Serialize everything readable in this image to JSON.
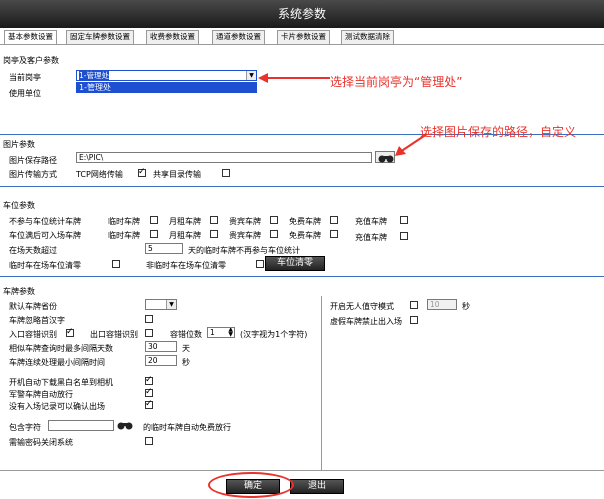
{
  "window": {
    "title": "系统参数"
  },
  "tabs": [
    "基本参数设置",
    "固定车牌参数设置",
    "收费参数设置",
    "通道参数设置",
    "卡片参数设置",
    "测试数据清除"
  ],
  "booth": {
    "section": "岗亭及客户参数",
    "current_label": "当前岗亭",
    "current_value": "1-管理处",
    "dropdown_option": "1-管理处",
    "unit_label": "使用单位"
  },
  "picture": {
    "section": "图片参数",
    "path_label": "图片保存路径",
    "path_value": "E:\\PIC\\",
    "mode_label": "图片传输方式",
    "tcp_label": "TCP网络传输",
    "share_label": "共享目录传输"
  },
  "parking": {
    "section": "车位参数",
    "row1_label": "不参与车位统计车牌",
    "row2_label": "车位满后可入场车牌",
    "types": [
      "临时车牌",
      "月租车牌",
      "贵宾车牌",
      "免费车牌",
      "充值车牌"
    ],
    "days_label": "在场天数超过",
    "days_value": "5",
    "days_suffix": "天的临时车牌不再参与车位统计",
    "temp_clear_label": "临时车在场车位清零",
    "nontemp_clear_label": "非临时车在场车位清零",
    "clear_button": "车位清零"
  },
  "plate": {
    "section": "车牌参数",
    "default_province_label": "默认车牌省份",
    "ignore_first_label": "车牌忽略首汉字",
    "entry_fault_label": "入口容错识别",
    "exit_fault_label": "出口容错识别",
    "fault_digits_label": "容错位数",
    "fault_digits_value": "1",
    "fault_digits_note": "(汉字视为1个字符)",
    "similar_days_label": "相似车牌查询时最多间隔天数",
    "similar_days_value": "30",
    "similar_days_unit": "天",
    "min_interval_label": "车牌连续处理最小间隔时间",
    "min_interval_value": "20",
    "min_interval_unit": "秒",
    "auto_download_label": "开机自动下载黑白名单到相机",
    "police_label": "军警车牌自动放行",
    "no_entry_label": "没有入场记录可以确认出场",
    "contains_label": "包含字符",
    "contains_suffix": "的临时车牌自动免费放行",
    "password_label": "需输密码关闭系统",
    "unattended_label": "开启无人值守模式",
    "unattended_value": "10",
    "unattended_unit": "秒",
    "fake_plate_label": "虚假车牌禁止出入场"
  },
  "footer": {
    "ok_button": "确定",
    "exit_button": "退出"
  },
  "annotations": {
    "a1": "选择当前岗亭为“管理处”",
    "a2": "选择图片保存的路径，自定义"
  },
  "colors": {
    "annotation": "#e8322b",
    "separator": "#3a6fbf"
  },
  "icons": {
    "browse": "binoculars-icon"
  }
}
